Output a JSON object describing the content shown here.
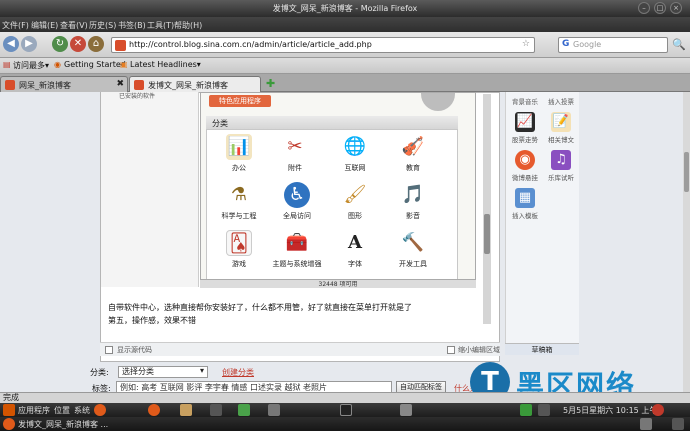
{
  "window": {
    "title": "发博文_网呆_新浪博客 - Mozilla Firefox",
    "minimize": "–",
    "maximize": "□",
    "close": "×"
  },
  "menu": {
    "items": [
      "文件(F)",
      "编辑(E)",
      "查看(V)",
      "历史(S)",
      "书签(B)",
      "工具(T)",
      "帮助(H)"
    ]
  },
  "nav": {
    "back": "◀",
    "forward": "▶",
    "reload": "↻",
    "stop": "✕",
    "home": "⌂",
    "url": "http://control.blog.sina.com.cn/admin/article/article_add.php",
    "search_placeholder": "Google",
    "search_engine": "G"
  },
  "bookmarks": {
    "items": [
      "访问最多▾",
      "Getting Started",
      "Latest Headlines▾"
    ]
  },
  "tabs": [
    {
      "label": "网呆_新浪博客",
      "active": false
    },
    {
      "label": "发博文_网呆_新浪博客",
      "active": true
    }
  ],
  "inner_app": {
    "side_text": "已安装的软件",
    "orange_button": "特色应用程序",
    "category_title": "分类",
    "categories": [
      {
        "label": "办公",
        "icon": "office-icon",
        "glyph": "📊",
        "color": "#e8c070"
      },
      {
        "label": "附件",
        "icon": "accessories-icon",
        "glyph": "✂",
        "color": "#cfcfcf"
      },
      {
        "label": "互联网",
        "icon": "internet-icon",
        "glyph": "🌐",
        "color": "#3d79b7"
      },
      {
        "label": "教育",
        "icon": "education-icon",
        "glyph": "🎻",
        "color": "#d9a34d"
      },
      {
        "label": "科学与工程",
        "icon": "science-icon",
        "glyph": "⚗",
        "color": "#c9b57d"
      },
      {
        "label": "全局访问",
        "icon": "accessibility-icon",
        "glyph": "♿",
        "color": "#2f73c0"
      },
      {
        "label": "图形",
        "icon": "graphics-icon",
        "glyph": "🖌",
        "color": "#e0b45a"
      },
      {
        "label": "影音",
        "icon": "multimedia-icon",
        "glyph": "🎵",
        "color": "#8a6b3b"
      },
      {
        "label": "游戏",
        "icon": "games-icon",
        "glyph": "🂡",
        "color": "#f0f0f0"
      },
      {
        "label": "主题与系统增强",
        "icon": "themes-icon",
        "glyph": "🧰",
        "color": "#c7a468"
      },
      {
        "label": "字体",
        "icon": "fonts-icon",
        "glyph": "A",
        "color": "#ffffff"
      },
      {
        "label": "开发工具",
        "icon": "devtools-icon",
        "glyph": "🔨",
        "color": "#d9d9d9"
      }
    ],
    "status": "32448 项可用"
  },
  "article": {
    "paragraph1": "自带软件中心，选种直接帮你安装好了，什么都不用管，好了就直接在菜单打开就是了",
    "paragraph2": "第五，操作感，效果不错",
    "show_source": "显示源代码",
    "mini_editor": "缩小编辑区域"
  },
  "rightbar": {
    "items": [
      {
        "label": "背景音乐",
        "icon": "music-icon",
        "glyph": "♪",
        "color": "#c7d3e6"
      },
      {
        "label": "插入投票",
        "icon": "vote-icon",
        "glyph": "☑",
        "color": "#c7d3e6"
      },
      {
        "label": "股票走势",
        "icon": "stock-icon",
        "glyph": "📈",
        "color": "#cc3333"
      },
      {
        "label": "相关博文",
        "icon": "related-icon",
        "glyph": "📝",
        "color": "#e8c070"
      },
      {
        "label": "微博悬挂",
        "icon": "weibo-icon",
        "glyph": "◉",
        "color": "#e65a2e"
      },
      {
        "label": "乐库试听",
        "icon": "music-lib-icon",
        "glyph": "♫",
        "color": "#8a4fc0"
      },
      {
        "label": "插入模板",
        "icon": "template-icon",
        "glyph": "▦",
        "color": "#5a8fd0"
      }
    ],
    "footer": "草稿箱"
  },
  "form": {
    "category_label": "分类:",
    "category_select": "选择分类",
    "create_category": "创建分类",
    "tag_label": "标签:",
    "tag_placeholder": "例如: 高考 互联网 影评 李宇春 情感 口述实录 越狱 老照片",
    "auto_tag": "自动匹配标签",
    "tag_link": "什么是标签"
  },
  "watermark": {
    "logo": "T",
    "text": "黑区网络"
  },
  "statusbar": {
    "text": "完成"
  },
  "taskbar": {
    "apps_menu": "应用程序",
    "places_menu": "位置",
    "system_menu": "系统",
    "datetime": "5月5日星期六 10:15 上午"
  },
  "bottombar": {
    "window_label": "发博文_网呆_新浪博客 ..."
  },
  "colors": {
    "accent": "#1b8ac9",
    "sina_red": "#d84d2b",
    "orange": "#e2663d"
  }
}
